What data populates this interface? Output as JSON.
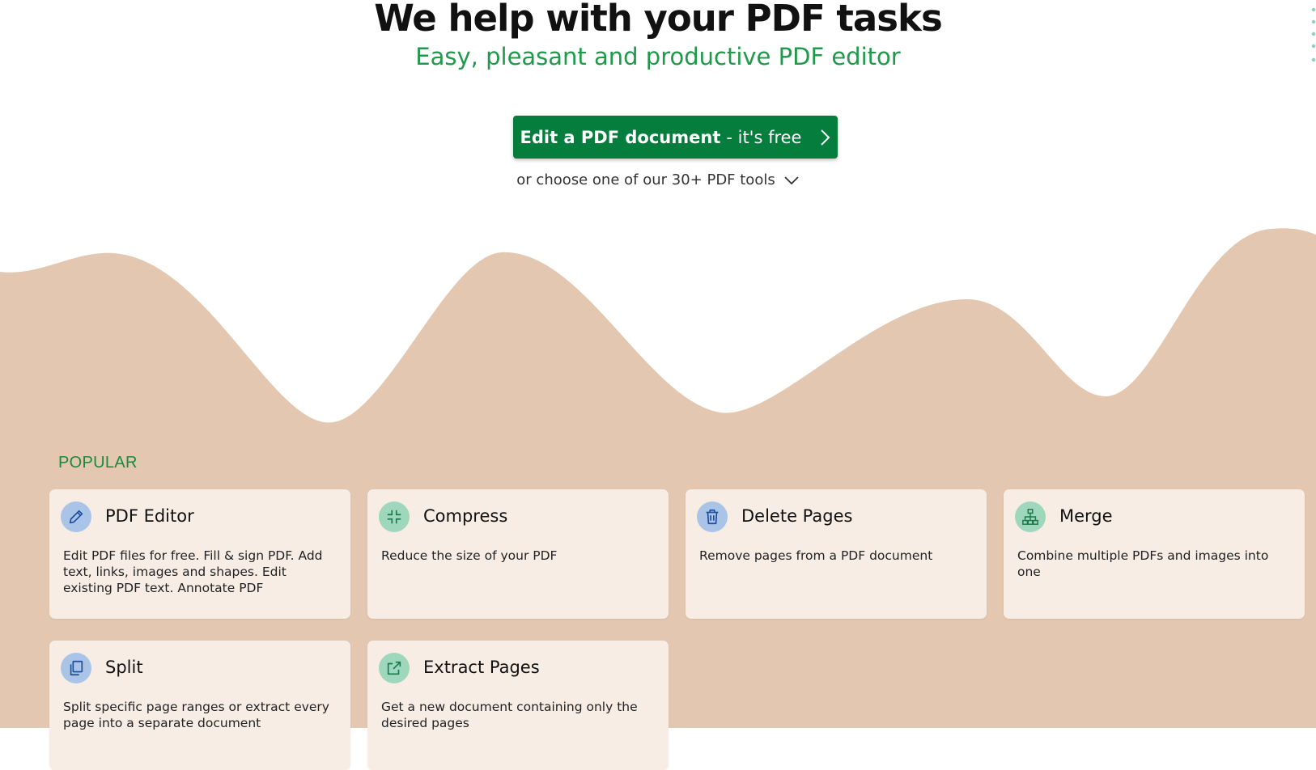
{
  "hero": {
    "title": "We help with your PDF tasks",
    "subtitle": "Easy, pleasant and productive PDF editor",
    "cta_bold": "Edit a PDF document",
    "cta_rest": "- it's free",
    "choose_text": "or choose one of our 30+ PDF tools"
  },
  "popular": {
    "label": "POPULAR",
    "tools": [
      {
        "name": "PDF Editor",
        "desc": "Edit PDF files for free. Fill & sign PDF. Add text, links, images and shapes. Edit existing PDF text. Annotate PDF",
        "icon": "pencil-icon"
      },
      {
        "name": "Compress",
        "desc": "Reduce the size of your PDF",
        "icon": "compress-icon"
      },
      {
        "name": "Delete Pages",
        "desc": "Remove pages from a PDF document",
        "icon": "trash-icon"
      },
      {
        "name": "Merge",
        "desc": "Combine multiple PDFs and images into one",
        "icon": "sitemap-icon"
      },
      {
        "name": "Split",
        "desc": "Split specific page ranges or extract every page into a separate document",
        "icon": "copy-icon"
      },
      {
        "name": "Extract Pages",
        "desc": "Get a new document containing only the desired pages",
        "icon": "external-link-icon"
      }
    ]
  },
  "colors": {
    "brand_green": "#047d3d",
    "accent_green": "#1f9a4b",
    "wave": "#e3c7b0",
    "card": "#f7ede4",
    "icon_blue_bg": "#a9c4e6",
    "icon_green_bg": "#9fd7bd"
  }
}
